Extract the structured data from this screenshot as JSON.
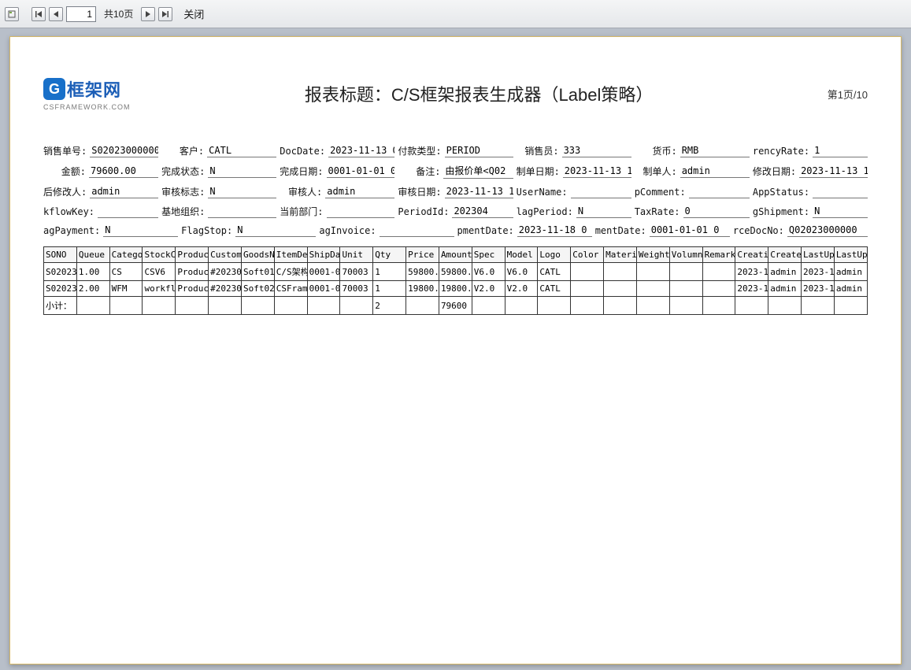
{
  "toolbar": {
    "page_input": "1",
    "page_total": "共10页",
    "close": "关闭"
  },
  "logo": {
    "brand": "框架网",
    "sub": "CSFRAMEWORK.COM"
  },
  "title": "报表标题：C/S框架报表生成器（Label策略）",
  "page_indicator": "第1页/10",
  "fields": [
    {
      "label": "销售单号:",
      "value": "S02023000000"
    },
    {
      "label": "客户:",
      "value": "CATL"
    },
    {
      "label": "DocDate:",
      "value": "2023-11-13 0"
    },
    {
      "label": "付款类型:",
      "value": "PERIOD"
    },
    {
      "label": "销售员:",
      "value": "333"
    },
    {
      "label": "货币:",
      "value": "RMB"
    },
    {
      "label": "rencyRate:",
      "value": "1"
    },
    {
      "label": "金额:",
      "value": "79600.00"
    },
    {
      "label": "完成状态:",
      "value": "N"
    },
    {
      "label": "完成日期:",
      "value": "0001-01-01 0"
    },
    {
      "label": "备注:",
      "value": "由报价单<Q02"
    },
    {
      "label": "制单日期:",
      "value": "2023-11-13 1"
    },
    {
      "label": "制单人:",
      "value": "admin"
    },
    {
      "label": "修改日期:",
      "value": "2023-11-13 1"
    },
    {
      "label": "后修改人:",
      "value": "admin"
    },
    {
      "label": "审核标志:",
      "value": "N"
    },
    {
      "label": "审核人:",
      "value": "admin"
    },
    {
      "label": "审核日期:",
      "value": "2023-11-13 1"
    },
    {
      "label": "UserName:",
      "value": ""
    },
    {
      "label": "pComment:",
      "value": ""
    },
    {
      "label": "AppStatus:",
      "value": ""
    },
    {
      "label": "kflowKey:",
      "value": ""
    },
    {
      "label": "基地组织:",
      "value": ""
    },
    {
      "label": "当前部门:",
      "value": ""
    },
    {
      "label": "PeriodId:",
      "value": "202304"
    },
    {
      "label": "lagPeriod:",
      "value": "N"
    },
    {
      "label": "TaxRate:",
      "value": "0"
    },
    {
      "label": "gShipment:",
      "value": "N"
    },
    {
      "label": "agPayment:",
      "value": "N"
    },
    {
      "label": "FlagStop:",
      "value": "N"
    },
    {
      "label": "agInvoice:",
      "value": ""
    },
    {
      "label": "pmentDate:",
      "value": "2023-11-18 0"
    },
    {
      "label": "mentDate:",
      "value": "0001-01-01 0"
    },
    {
      "label": "rceDocNo:",
      "value": "Q02023000000"
    }
  ],
  "table": {
    "headers": [
      "SONO",
      "Queue",
      "Catego",
      "StockC",
      "Produc",
      "Custom",
      "GoodsN",
      "ItemDe",
      "ShipDa",
      "Unit",
      "Qty",
      "Price",
      "Amount",
      "Spec",
      "Model",
      "Logo",
      "Color",
      "Materi",
      "Weight",
      "Volumn",
      "Remark",
      "Creati",
      "Create",
      "LastUp",
      "LastUp"
    ],
    "rows": [
      [
        "S02023",
        "1.00",
        "CS",
        "CSV6",
        "Produc",
        "#20230",
        "Soft01",
        "C/S架构",
        "0001-0",
        "70003",
        "1",
        "59800.",
        "59800.",
        "V6.0",
        "V6.0",
        "CATL",
        "",
        "",
        "",
        "",
        "",
        "2023-1",
        "admin",
        "2023-1",
        "admin"
      ],
      [
        "S02023",
        "2.00",
        "WFM",
        "workfl",
        "Produc",
        "#20230",
        "Soft02",
        "CSFram",
        "0001-0",
        "70003",
        "1",
        "19800.",
        "19800.",
        "V2.0",
        "V2.0",
        "CATL",
        "",
        "",
        "",
        "",
        "",
        "2023-1",
        "admin",
        "2023-1",
        "admin"
      ]
    ],
    "subtotal_label": "小计：",
    "subtotal": {
      "qty": "2",
      "amount": "79600"
    }
  }
}
